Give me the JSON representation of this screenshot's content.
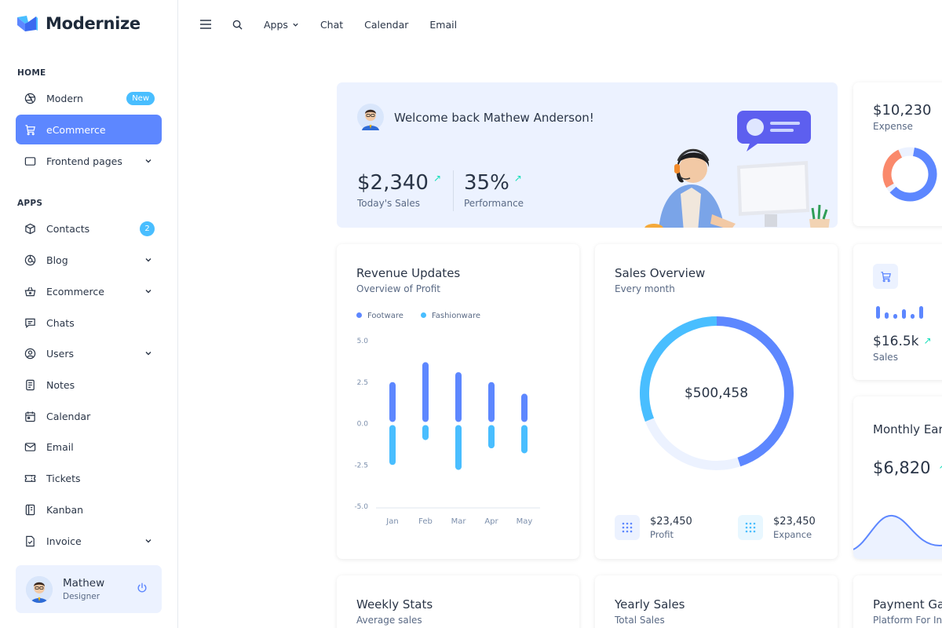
{
  "app": {
    "name": "Modernize"
  },
  "sidebar": {
    "home_label": "HOME",
    "apps_label": "APPS",
    "home_items": [
      {
        "label": "Modern",
        "icon": "aperture-icon",
        "badge": "New"
      },
      {
        "label": "eCommerce",
        "icon": "shopping-cart-icon",
        "active": true
      },
      {
        "label": "Frontend pages",
        "icon": "window-icon",
        "has_children": true
      }
    ],
    "apps_items": [
      {
        "label": "Contacts",
        "icon": "package-icon",
        "count": "2"
      },
      {
        "label": "Blog",
        "icon": "chart-donut-icon",
        "has_children": true
      },
      {
        "label": "Ecommerce",
        "icon": "basket-icon",
        "has_children": true
      },
      {
        "label": "Chats",
        "icon": "message-icon"
      },
      {
        "label": "Users",
        "icon": "user-circle-icon",
        "has_children": true
      },
      {
        "label": "Notes",
        "icon": "notes-icon"
      },
      {
        "label": "Calendar",
        "icon": "calendar-icon"
      },
      {
        "label": "Email",
        "icon": "mail-icon"
      },
      {
        "label": "Tickets",
        "icon": "ticket-icon"
      },
      {
        "label": "Kanban",
        "icon": "kanban-icon"
      },
      {
        "label": "Invoice",
        "icon": "file-check-icon",
        "has_children": true
      }
    ],
    "profile": {
      "name": "Mathew",
      "role": "Designer"
    }
  },
  "topbar": {
    "items": [
      "Apps",
      "Chat",
      "Calendar",
      "Email"
    ]
  },
  "welcome": {
    "title": "Welcome back Mathew Anderson!",
    "sales_value": "$2,340",
    "sales_label": "Today's Sales",
    "perf_value": "35%",
    "perf_label": "Performance"
  },
  "expense": {
    "value": "$10,230",
    "label": "Expense"
  },
  "revenue": {
    "title": "Revenue Updates",
    "subtitle": "Overview of Profit",
    "legend": [
      "Footware",
      "Fashionware"
    ]
  },
  "sales_overview": {
    "title": "Sales Overview",
    "subtitle": "Every month",
    "center_value": "$500,458",
    "profit_value": "$23,450",
    "profit_label": "Profit",
    "expense_value": "$23,450",
    "expense_label": "Expance",
    "profit_fraction": 0.45
  },
  "sales_card": {
    "value": "$16.5k",
    "label": "Sales"
  },
  "monthly": {
    "title": "Monthly Earn",
    "value": "$6,820"
  },
  "bottom": {
    "weekly_title": "Weekly Stats",
    "weekly_sub": "Average sales",
    "yearly_title": "Yearly Sales",
    "yearly_sub": "Total Sales",
    "payment_title": "Payment Ga",
    "payment_sub": "Platform For Inc"
  },
  "colors": {
    "primary": "#5d87ff",
    "secondary": "#49beff",
    "success": "#13deb9",
    "light_primary": "#ecf2ff"
  },
  "chart_data": {
    "type": "bar",
    "categories": [
      "Jan",
      "Feb",
      "Mar",
      "Apr",
      "May"
    ],
    "yticks": [
      "5.0",
      "2.5",
      "0.0",
      "-2.5",
      "-5.0"
    ],
    "ylim": [
      -5,
      5
    ],
    "series": [
      {
        "name": "Footware",
        "values": [
          2.5,
          3.7,
          3.1,
          2.5,
          1.8
        ]
      },
      {
        "name": "Fashionware",
        "values": [
          -2.5,
          -1.0,
          -2.8,
          -1.5,
          -1.8
        ]
      }
    ],
    "legend_position": "top-left",
    "grid": false
  }
}
